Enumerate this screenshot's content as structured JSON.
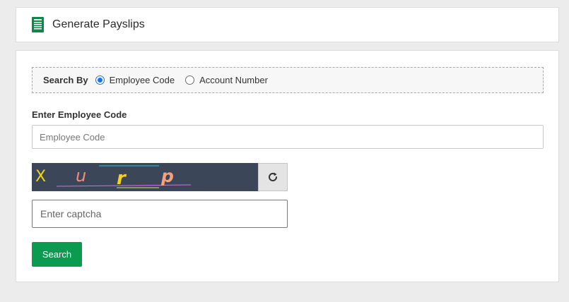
{
  "header": {
    "title": "Generate Payslips",
    "icon": "document-icon"
  },
  "search_by": {
    "label": "Search By",
    "options": [
      {
        "label": "Employee Code",
        "selected": true
      },
      {
        "label": "Account Number",
        "selected": false
      }
    ]
  },
  "employee_code": {
    "label": "Enter Employee Code",
    "placeholder": "Employee Code",
    "value": ""
  },
  "captcha": {
    "characters": [
      "X",
      "u",
      "r",
      "p"
    ],
    "refresh_icon": "refresh-icon",
    "input_placeholder": "Enter captcha",
    "input_value": ""
  },
  "actions": {
    "search_label": "Search"
  },
  "colors": {
    "accent_green": "#0a9b50",
    "radio_blue": "#1a73e8",
    "captcha_bg": "#3b4659"
  }
}
